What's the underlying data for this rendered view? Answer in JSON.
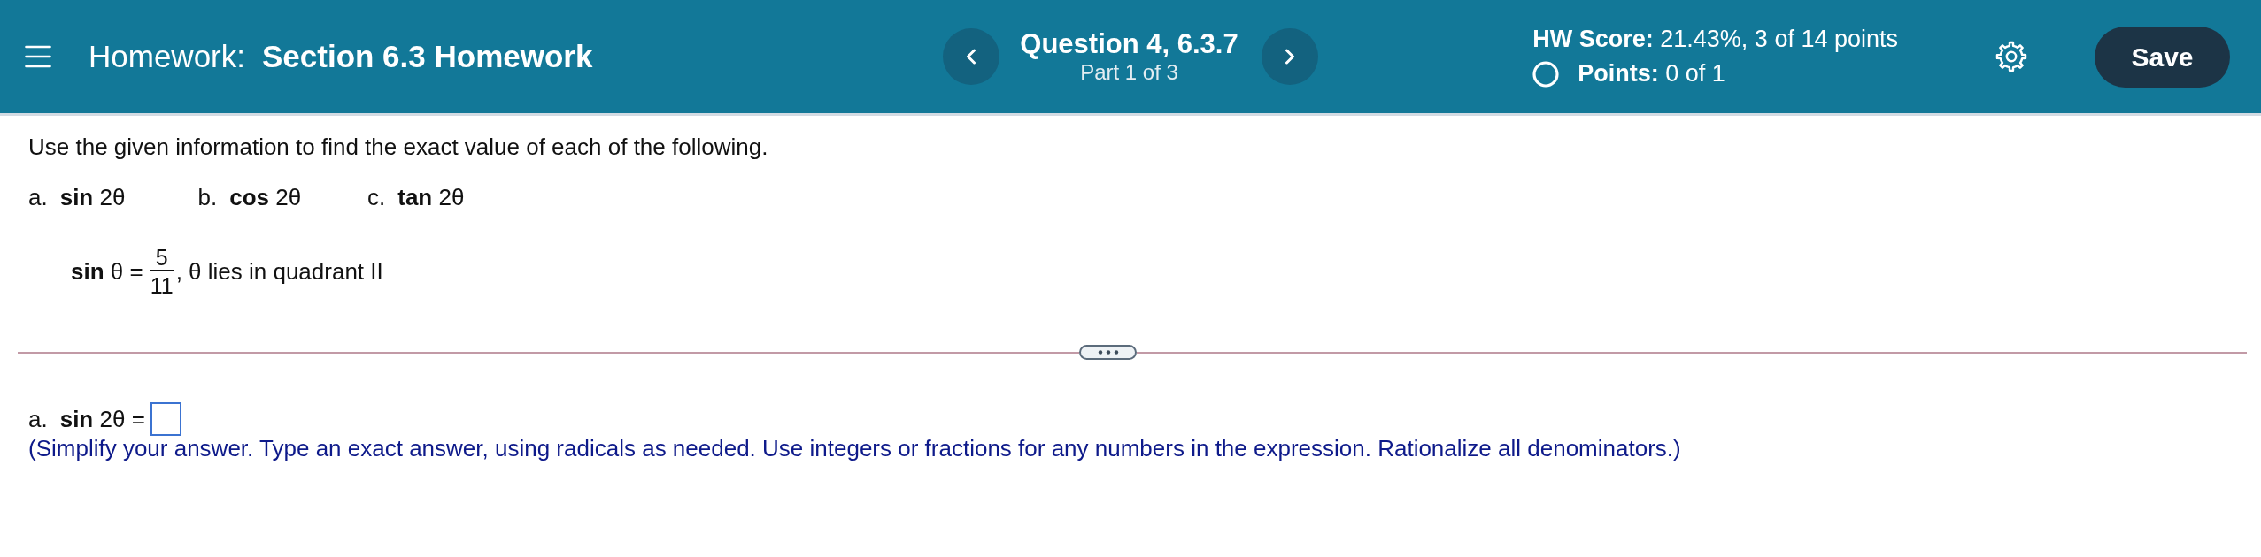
{
  "header": {
    "title_prefix": "Homework:",
    "title": "Section 6.3 Homework",
    "question": {
      "title": "Question 4, 6.3.7",
      "part": "Part 1 of 3"
    },
    "score": "**HW Score:** 21.43%, 3 of 14 points",
    "points": "**Points:** 0 of 1",
    "save_button": "Save"
  },
  "question": {
    "instruction": "Use the given information to find the exact value of each of the following.",
    "parts": [
      {
        "letter": "a.",
        "expression": "**sin** 2θ"
      },
      {
        "letter": "b.",
        "expression": "**cos** 2θ"
      },
      {
        "letter": "c.",
        "expression": "**tan** 2θ"
      }
    ],
    "given": {
      "lhs": "**sin** θ =",
      "numerator": "5",
      "denominator": "11",
      "condition": ", θ lies in quadrant II"
    }
  },
  "answer": {
    "letter": "a.",
    "expression": "**sin** 2θ =",
    "hint": "(Simplify your answer. Type an exact answer, using radicals as needed. Use integers or fractions for any numbers in the expression. Rationalize all denominators.)"
  }
}
